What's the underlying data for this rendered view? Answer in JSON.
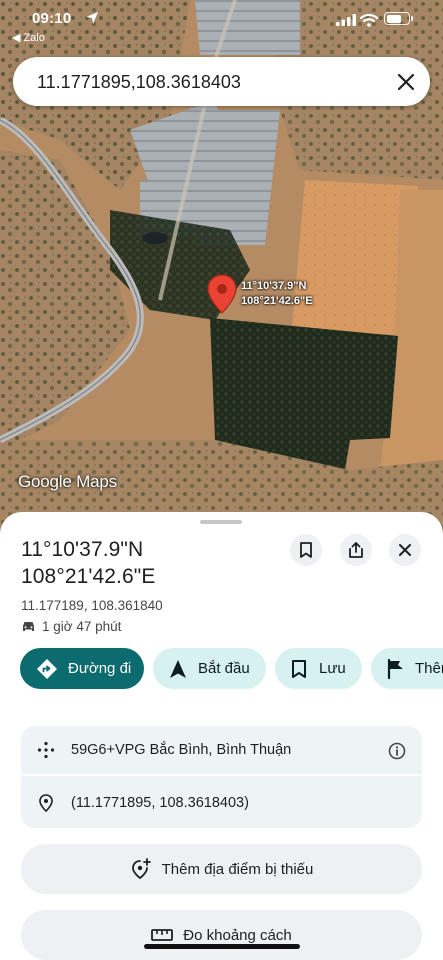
{
  "status_bar": {
    "time": "09:10",
    "back_app": "◀ Zalo"
  },
  "search": {
    "value": "11.1771895,108.3618403"
  },
  "map": {
    "pin_label_lines": [
      "11°10'37.9\"N",
      "108°21'42.6\"E"
    ],
    "logo": "Google Maps",
    "pin_color": "#ea4335"
  },
  "place": {
    "title_line1": "11°10'37.9\"N",
    "title_line2": "108°21'42.6\"E",
    "decimal": "11.177189, 108.361840",
    "drive_time": "1 giờ 47 phút"
  },
  "actions": [
    {
      "label": "Đường đi",
      "icon": "directions-icon"
    },
    {
      "label": "Bắt đầu",
      "icon": "navigation-arrow-icon"
    },
    {
      "label": "Lưu",
      "icon": "bookmark-icon"
    },
    {
      "label": "Thêm",
      "icon": "flag-icon"
    }
  ],
  "info": {
    "plus_code": "59G6+VPG Bắc Bình, Bình Thuận",
    "coordinates": "(11.1771895, 108.3618403)"
  },
  "add_missing_place": "Thêm địa điểm bị thiếu",
  "measure_distance": "Đo khoảng cách",
  "colors": {
    "primary": "#0b6b6e",
    "tonal": "#d7f1f1",
    "card": "#eef3f6"
  }
}
